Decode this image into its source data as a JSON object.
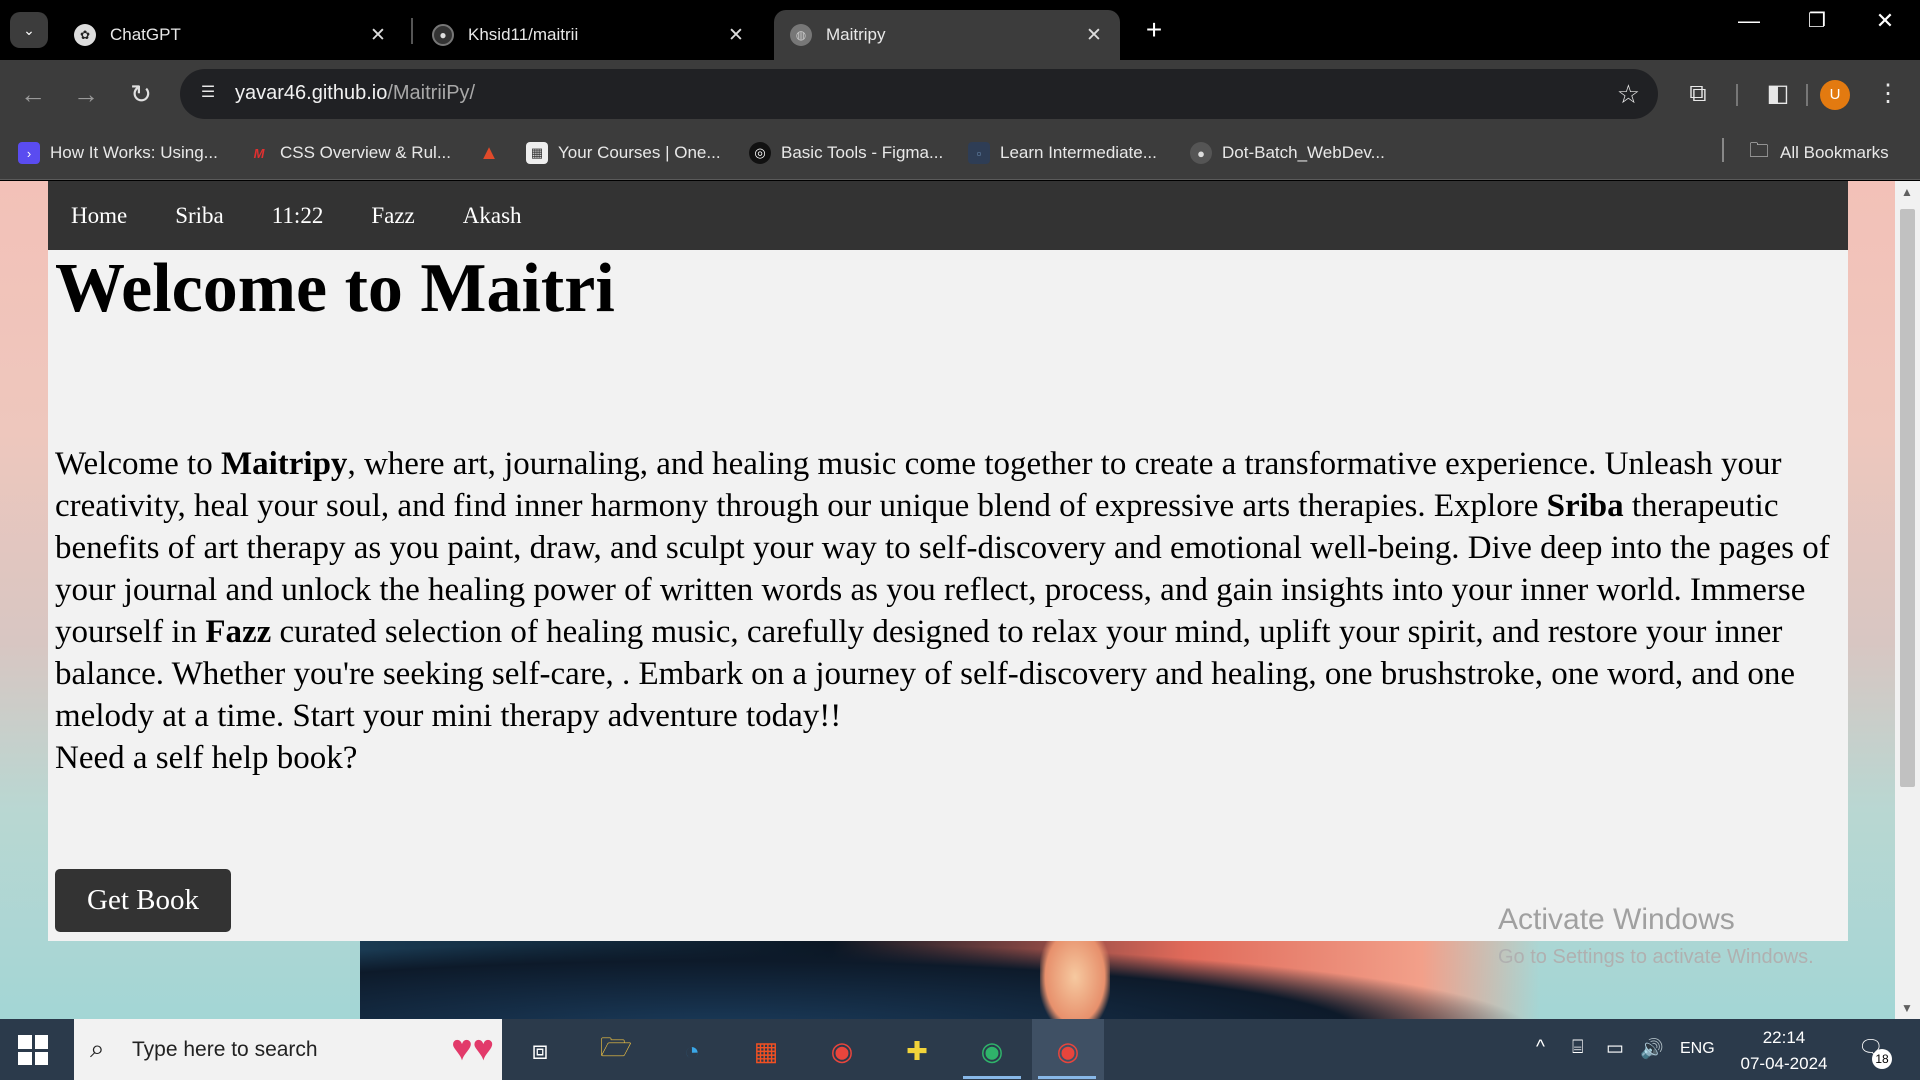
{
  "browser": {
    "tabs": [
      {
        "title": "ChatGPT",
        "icon": "chatgpt-icon"
      },
      {
        "title": "Khsid11/maitrii",
        "icon": "github-icon"
      },
      {
        "title": "Maitripy",
        "icon": "globe-icon",
        "active": true
      }
    ],
    "url_host": "yavar46.github.io",
    "url_path": "/MaitriiPy/",
    "profile_initial": "U",
    "bookmarks": [
      "How It Works: Using...",
      "CSS Overview & Rul...",
      "",
      "Your Courses | One...",
      "Basic Tools - Figma...",
      "Learn Intermediate...",
      "Dot-Batch_WebDev..."
    ],
    "all_bookmarks": "All Bookmarks"
  },
  "site": {
    "nav": [
      "Home",
      "Sriba",
      "11:22",
      "Fazz",
      "Akash"
    ],
    "heading": "Welcome to Maitri",
    "paragraph": {
      "p1": "Welcome to ",
      "b1": "Maitripy",
      "p2": ", where art, journaling, and healing music come together to create a transformative experience. Unleash your creativity, heal your soul, and find inner harmony through our unique blend of expressive arts therapies. Explore ",
      "b2": "Sriba",
      "p3": " therapeutic benefits of art therapy as you paint, draw, and sculpt your way to self-discovery and emotional well-being. Dive deep into the pages of your journal and unlock the healing power of written words as you reflect, process, and gain insights into your inner world. Immerse yourself in ",
      "b3": "Fazz",
      "p4": " curated selection of healing music, carefully designed to relax your mind, uplift your spirit, and restore your inner balance. Whether you're seeking self-care, . Embark on a journey of self-discovery and healing, one brushstroke, one word, and one melody at a time. Start your mini therapy adventure today!!",
      "p5": "Need a self help book?"
    },
    "button": "Get Book"
  },
  "watermark": {
    "line1": "Activate Windows",
    "line2": "Go to Settings to activate Windows."
  },
  "taskbar": {
    "search_placeholder": "Type here to search",
    "language": "ENG",
    "time": "22:14",
    "date": "07-04-2024",
    "notifications": "18"
  },
  "colors": {
    "site_nav_bg": "#333333",
    "button_bg": "#333333",
    "profile": "#e37a10",
    "taskbar": "#2b3a4b"
  }
}
